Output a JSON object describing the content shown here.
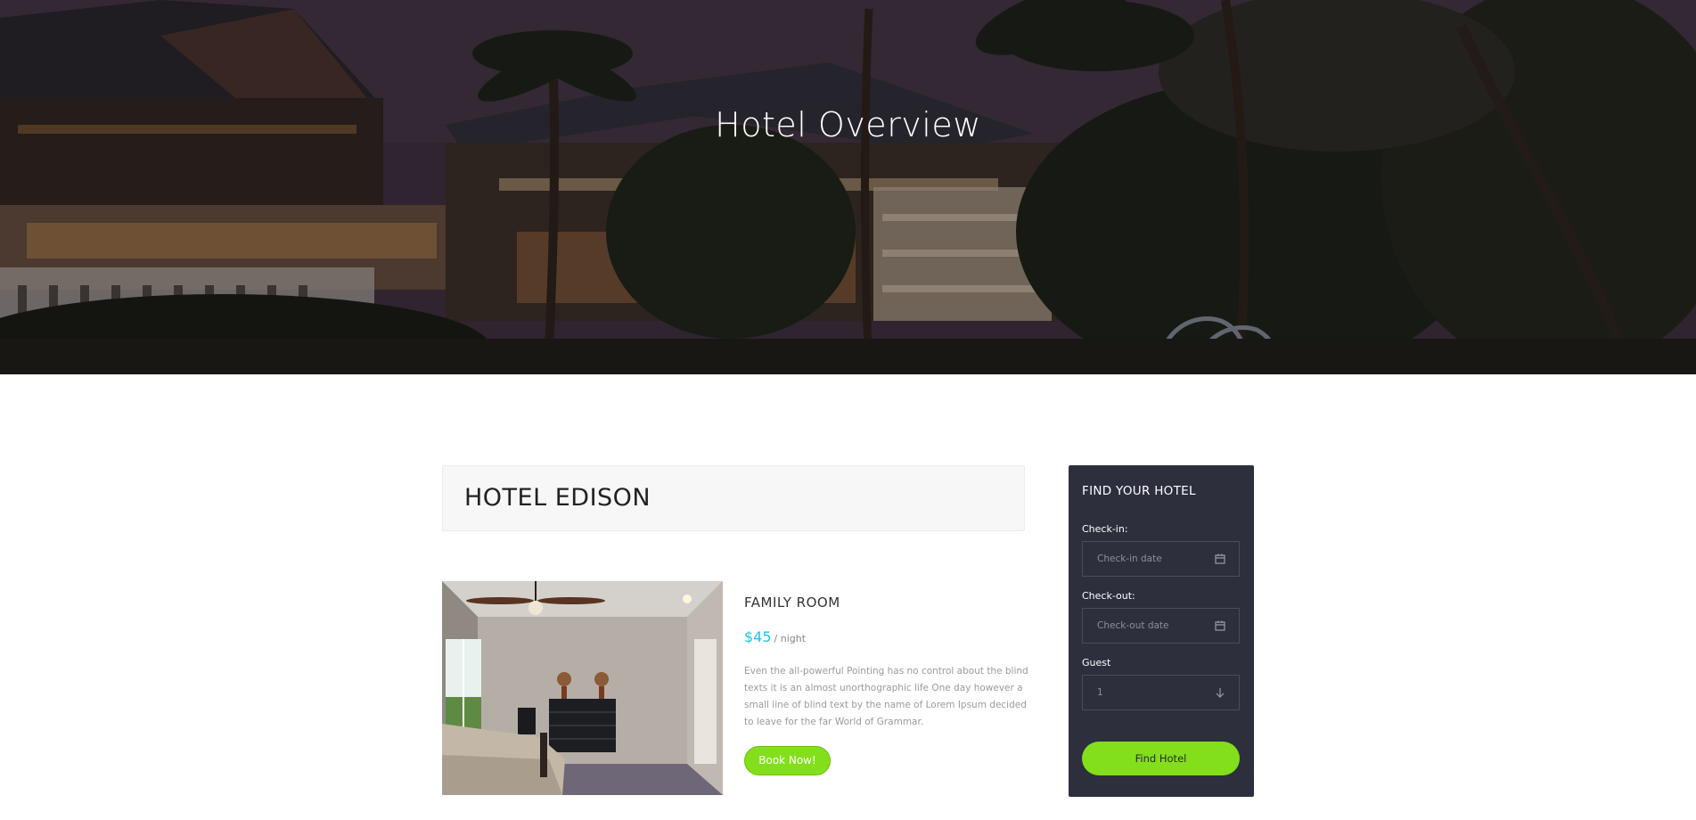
{
  "hero": {
    "title": "Hotel Overview"
  },
  "hotel": {
    "name": "HOTEL EDISON"
  },
  "room": {
    "title": "FAMILY ROOM",
    "price": "$45",
    "per": "/ night",
    "description": "Even the all-powerful Pointing has no control about the blind texts it is an almost unorthographic life One day however a small line of blind text by the name of Lorem Ipsum decided to leave for the far World of Grammar.",
    "book_label": "Book Now!"
  },
  "finder": {
    "title": "FIND YOUR HOTEL",
    "checkin_label": "Check-in:",
    "checkin_placeholder": "Check-in date",
    "checkout_label": "Check-out:",
    "checkout_placeholder": "Check-out date",
    "guest_label": "Guest",
    "guest_value": "1",
    "button_label": "Find Hotel"
  },
  "colors": {
    "accent_green": "#83de1c",
    "price_blue": "#1ec5e6",
    "sidebar_bg": "#2d2f3d"
  },
  "icons": {
    "checkin": "calendar-icon",
    "checkout": "calendar-icon",
    "guest": "arrow-down-icon"
  }
}
